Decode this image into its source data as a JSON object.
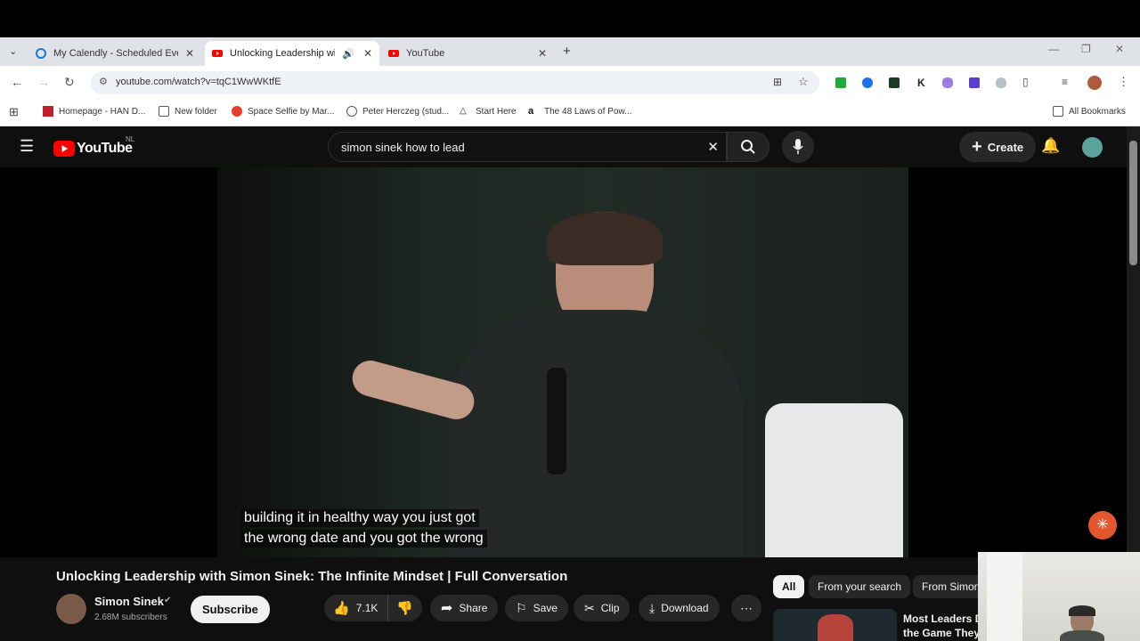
{
  "tabs": [
    {
      "label": "My Calendly - Scheduled Event...",
      "active": false
    },
    {
      "label": "Unlocking Leadership with",
      "active": true
    },
    {
      "label": "YouTube",
      "active": false
    }
  ],
  "address": {
    "url": "youtube.com/watch?v=tqC1WwWKtfE"
  },
  "bookmarks": [
    {
      "label": "Homepage - HAN D..."
    },
    {
      "label": "New folder"
    },
    {
      "label": "Space Selfie by Mar..."
    },
    {
      "label": "Peter Herczeg (stud..."
    },
    {
      "label": "Start Here"
    },
    {
      "label": "The 48 Laws of Pow..."
    }
  ],
  "all_bookmarks": "All Bookmarks",
  "youtube": {
    "logo": "YouTube",
    "region": "NL",
    "search_value": "simon sinek how to lead",
    "create_label": "Create"
  },
  "video": {
    "caption_line1": "building it in healthy way you just got",
    "caption_line2": "the wrong date and you got the wrong",
    "title": "Unlocking Leadership with Simon Sinek: The Infinite Mindset | Full Conversation",
    "channel": "Simon Sinek",
    "subscribers": "2.68M subscribers",
    "subscribe_label": "Subscribe",
    "likes": "7.1K",
    "share_label": "Share",
    "save_label": "Save",
    "clip_label": "Clip",
    "download_label": "Download"
  },
  "filter_chips": [
    "All",
    "From your search",
    "From Simon"
  ],
  "related": {
    "title_line1": "Most Leaders Do",
    "title_line2": "the Game They'r"
  },
  "colors": {
    "yt_red": "#ff0000",
    "page_bg": "#0f0f0f",
    "chip_active_bg": "#f1f1f1"
  }
}
